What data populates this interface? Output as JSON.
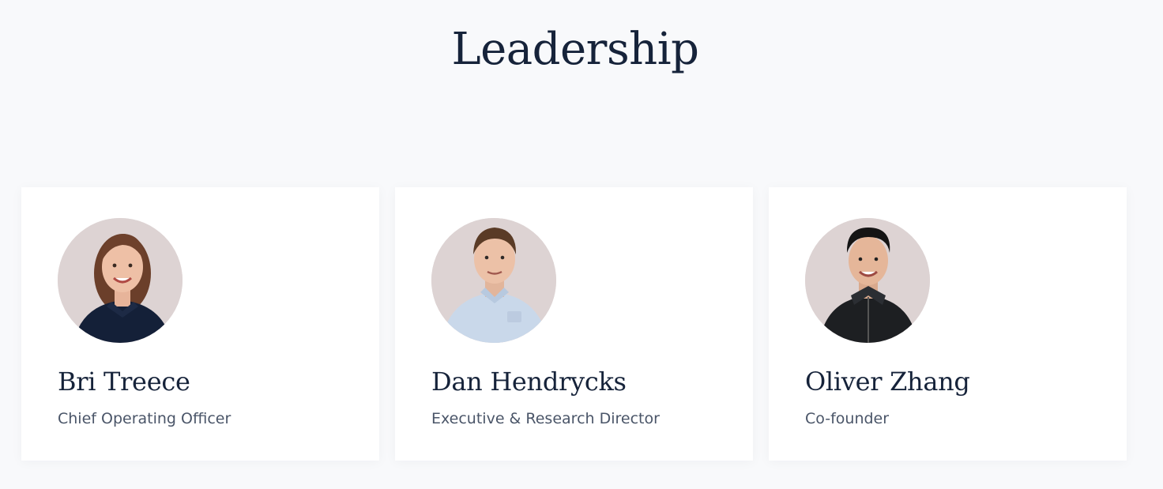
{
  "section": {
    "title": "Leadership"
  },
  "people": [
    {
      "name": "Bri Treece",
      "role": "Chief Operating Officer",
      "avatar_icon": "portrait-photo"
    },
    {
      "name": "Dan Hendrycks",
      "role": "Executive & Research Director",
      "avatar_icon": "portrait-photo"
    },
    {
      "name": "Oliver Zhang",
      "role": "Co-founder",
      "avatar_icon": "portrait-photo"
    }
  ],
  "colors": {
    "background": "#f8f9fb",
    "card": "#ffffff",
    "heading": "#16233a",
    "subtext": "#4a5568",
    "avatar_bg": "#ddd3d3"
  }
}
